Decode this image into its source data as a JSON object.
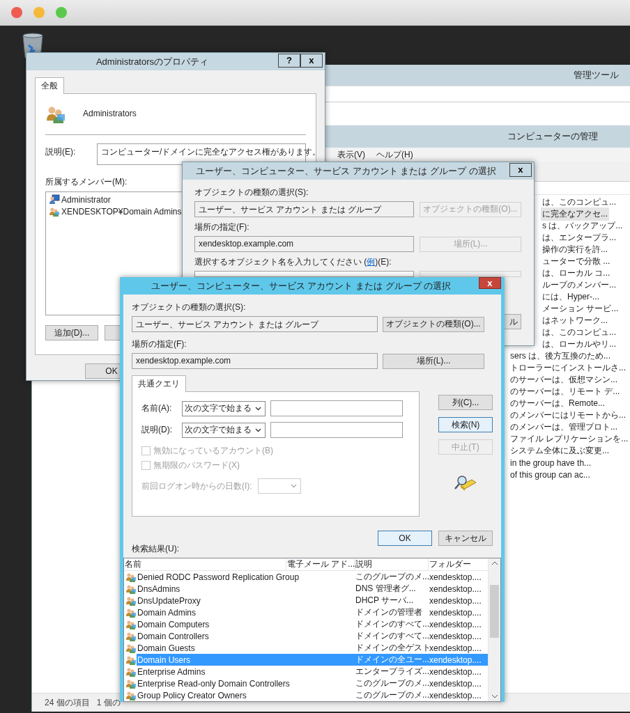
{
  "tools_window": {
    "title": "管理ツール"
  },
  "computer_management": {
    "title": "コンピューターの管理",
    "menu": [
      "表示(V)",
      "ヘルプ(H)"
    ],
    "list_rows": [
      {
        "text": "は、このコンピュ...",
        "selected": false
      },
      {
        "text": "に完全なアクセ...",
        "selected": true
      },
      {
        "text": "s は、バックアップ...",
        "selected": false
      },
      {
        "text": "は、エンタープラ...",
        "selected": false
      },
      {
        "text": "操作の実行を許...",
        "selected": false
      },
      {
        "text": "ューターで分散 ...",
        "selected": false
      },
      {
        "text": "は、ローカル コ...",
        "selected": false
      },
      {
        "text": "ループのメンバー...",
        "selected": false
      },
      {
        "text": "には、Hyper-...",
        "selected": false
      },
      {
        "text": "メーション サービ...",
        "selected": false
      },
      {
        "text": "はネットワーク...",
        "selected": false
      },
      {
        "text": "は、このコンピュ...",
        "selected": false
      },
      {
        "text": "は、ローカルやリ...",
        "selected": false
      },
      {
        "text": "sers は、後方互換のため...",
        "selected": false
      },
      {
        "text": "トローラーにインストールさ...",
        "selected": false
      },
      {
        "text": "のサーバーは、仮想マシン...",
        "selected": false
      },
      {
        "text": "のサーバーは、リモート デ...",
        "selected": false
      },
      {
        "text": "のサーバーは、Remote...",
        "selected": false
      },
      {
        "text": "のメンバーにはリモートから...",
        "selected": false
      },
      {
        "text": "のメンバーは、管理プロト...",
        "selected": false
      },
      {
        "text": "ファイル レプリケーションを...",
        "selected": false
      },
      {
        "text": "システム全体に及ぶ変更...",
        "selected": false
      },
      {
        "text": "in the group have th...",
        "selected": false
      },
      {
        "text": "of this group can ac...",
        "selected": false
      }
    ],
    "status_bar": [
      "24 個の項目",
      "1 個の"
    ]
  },
  "properties_dialog": {
    "title": "Administratorsのプロパティ",
    "help_button": "?",
    "close_button": "x",
    "tabs": [
      {
        "label": "全般",
        "selected": true
      }
    ],
    "group_name": "Administrators",
    "description_label": "説明(E):",
    "description": "コンピューター/ドメインに完全なアクセス権があります。",
    "members_label": "所属するメンバー(M):",
    "members": [
      {
        "name": "Administrator",
        "kind": "user"
      },
      {
        "name": "XENDESKTOP¥Domain Admins",
        "kind": "group"
      }
    ],
    "add_button": "追加(D)...",
    "ok_button": "OK"
  },
  "select_dialog_back": {
    "title": "ユーザー、コンピューター、サービス アカウント または グループ の選択",
    "close_button": "x",
    "object_type_label": "オブジェクトの種類の選択(S):",
    "object_type": "ユーザー、サービス アカウント または グループ",
    "object_type_button": {
      "label": "オブジェクトの種類(O)...",
      "disabled": true
    },
    "location_label": "場所の指定(F):",
    "location": "xendesktop.example.com",
    "location_button": {
      "label": "場所(L)...",
      "disabled": true
    },
    "enter_label_before": "選択するオブジェクト名を入力してください (",
    "enter_link": "例",
    "enter_label_after": ")(E):",
    "cancel_fragment": "ル"
  },
  "select_dialog": {
    "title": "ユーザー、コンピューター、サービス アカウント または グループ の選択",
    "close_button": "x",
    "object_type_label": "オブジェクトの種類の選択(S):",
    "object_type": "ユーザー、サービス アカウント または グループ",
    "object_type_button": {
      "label": "オブジェクトの種類(O)...",
      "disabled": false
    },
    "location_label": "場所の指定(F):",
    "location": "xendesktop.example.com",
    "location_button": {
      "label": "場所(L)...",
      "disabled": false
    },
    "query_tabs": [
      {
        "label": "共通クエリ",
        "selected": true
      }
    ],
    "name_label": "名前(A):",
    "name_mode": "次の文字で始まる",
    "desc_label": "説明(D):",
    "desc_mode": "次の文字で始まる",
    "checkboxes": [
      {
        "label": "無効になっているアカウント(B)",
        "checked": false,
        "disabled": true
      },
      {
        "label": "無期限のパスワード(X)",
        "checked": false,
        "disabled": true
      }
    ],
    "days": {
      "label": "前回ログオン時からの日数(I):",
      "disabled": true
    },
    "side_buttons": [
      {
        "label": "列(C)...",
        "disabled": false,
        "focused": false
      },
      {
        "label": "検索(N)",
        "disabled": false,
        "focused": true
      },
      {
        "label": "中止(T)",
        "disabled": true,
        "focused": false
      }
    ],
    "ok_button": "OK",
    "cancel_button": "キャンセル",
    "results_label": "検索結果(U):",
    "columns": [
      "名前",
      "電子メール アド...",
      "説明",
      "フォルダー"
    ],
    "rows": [
      {
        "name": "Denied RODC Password Replication Group",
        "description": "このグループのメ...",
        "folder": "xendesktop....",
        "selected": false
      },
      {
        "name": "DnsAdmins",
        "description": "DNS 管理者グ...",
        "folder": "xendesktop....",
        "selected": false
      },
      {
        "name": "DnsUpdateProxy",
        "description": "DHCP サーバ...",
        "folder": "xendesktop....",
        "selected": false
      },
      {
        "name": "Domain Admins",
        "description": "ドメインの管理者",
        "folder": "xendesktop....",
        "selected": false
      },
      {
        "name": "Domain Computers",
        "description": "ドメインのすべて...",
        "folder": "xendesktop....",
        "selected": false
      },
      {
        "name": "Domain Controllers",
        "description": "ドメインのすべて...",
        "folder": "xendesktop....",
        "selected": false
      },
      {
        "name": "Domain Guests",
        "description": "ドメインの全ゲスト",
        "folder": "xendesktop....",
        "selected": false
      },
      {
        "name": "Domain Users",
        "description": "ドメインの全ユー...",
        "folder": "xendesktop....",
        "selected": true
      },
      {
        "name": "Enterprise Admins",
        "description": "エンタープライズ...",
        "folder": "xendesktop....",
        "selected": false
      },
      {
        "name": "Enterprise Read-only Domain Controllers",
        "description": "このグループのメ...",
        "folder": "xendesktop....",
        "selected": false
      },
      {
        "name": "Group Policy Creator Owners",
        "description": "このグループのメ...",
        "folder": "xendesktop....",
        "selected": false
      }
    ]
  }
}
